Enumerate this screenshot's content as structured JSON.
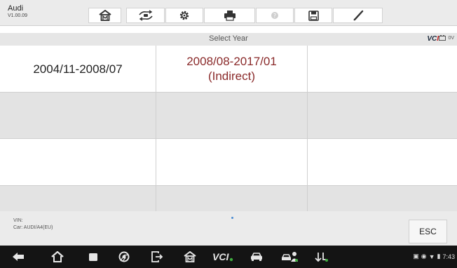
{
  "app": {
    "name": "Audi",
    "version": "V1.00.09"
  },
  "toolbar": {
    "icons": [
      "home-icon",
      "vehicle-swap-icon",
      "settings-gear-icon",
      "printer-icon",
      "help-icon",
      "save-icon",
      "pen-icon"
    ]
  },
  "header": {
    "title": "Select Year",
    "vci_label": "VCI",
    "battery_voltage": "0V"
  },
  "years": [
    [
      "2004/11-2008/07",
      "2008/08-2017/01\n(Indirect)",
      ""
    ],
    [
      "",
      "",
      ""
    ],
    [
      "",
      "",
      ""
    ],
    [
      "",
      "",
      ""
    ]
  ],
  "colors": {
    "selected_text": "#8a2a2a",
    "normal_text": "#222222",
    "row_alt": "#e3e3e3"
  },
  "footer": {
    "vin_label": "VIN:",
    "car_label": "Car: AUDI/A4(EU)",
    "esc_label": "ESC"
  },
  "navbar": {
    "icons": [
      "back-icon",
      "home-icon",
      "recent-apps-icon",
      "chrome-icon",
      "exit-icon",
      "autel-home-icon",
      "vci-icon",
      "car-icon",
      "car-shop-icon",
      "bluetooth-update-icon"
    ]
  },
  "status": {
    "time": "7:43"
  }
}
